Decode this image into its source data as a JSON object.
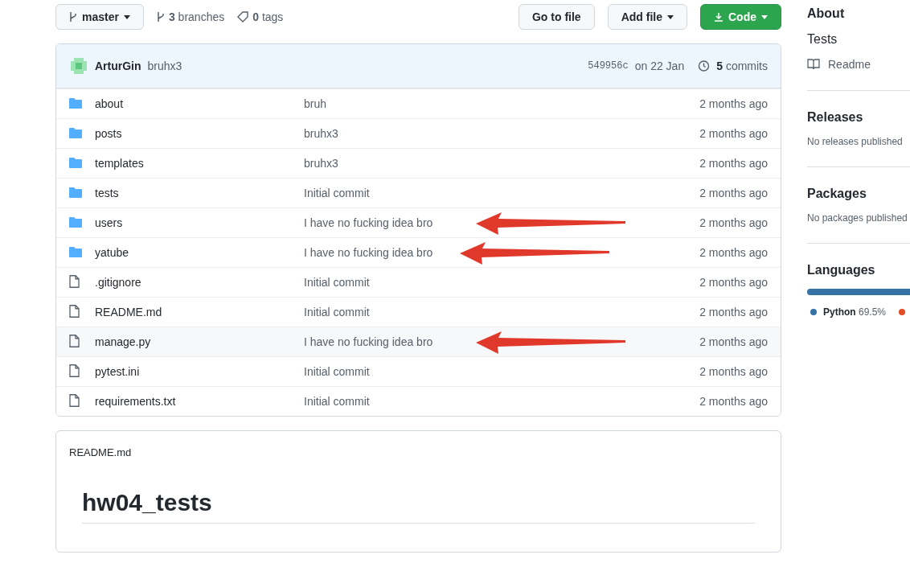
{
  "toolbar": {
    "branch": "master",
    "branches": {
      "count": "3",
      "label": "branches"
    },
    "tags": {
      "count": "0",
      "label": "tags"
    },
    "buttons": [
      {
        "kind": "plain",
        "label": "Go to file"
      },
      {
        "kind": "menu",
        "label": "Add file"
      },
      {
        "kind": "primary",
        "label": "Code"
      }
    ]
  },
  "commit_bar": {
    "author": "ArturGin",
    "message": "bruhx3",
    "hash": "549956c",
    "date": "on 22 Jan",
    "commits": {
      "count": "5",
      "label": "commits"
    }
  },
  "files": [
    {
      "kind": "folder",
      "name": "about",
      "message": "bruh",
      "age": "2 months ago",
      "highlighted": false,
      "arrow": false
    },
    {
      "kind": "folder",
      "name": "posts",
      "message": "bruhx3",
      "age": "2 months ago",
      "highlighted": false,
      "arrow": false
    },
    {
      "kind": "folder",
      "name": "templates",
      "message": "bruhx3",
      "age": "2 months ago",
      "highlighted": false,
      "arrow": false
    },
    {
      "kind": "folder",
      "name": "tests",
      "message": "Initial commit",
      "age": "2 months ago",
      "highlighted": false,
      "arrow": false
    },
    {
      "kind": "folder",
      "name": "users",
      "message": "I have no fucking idea bro",
      "age": "2 months ago",
      "highlighted": false,
      "arrow": true
    },
    {
      "kind": "folder",
      "name": "yatube",
      "message": "I have no fucking idea bro",
      "age": "2 months ago",
      "highlighted": false,
      "arrow": true
    },
    {
      "kind": "file",
      "name": ".gitignore",
      "message": "Initial commit",
      "age": "2 months ago",
      "highlighted": false,
      "arrow": false
    },
    {
      "kind": "file",
      "name": "README.md",
      "message": "Initial commit",
      "age": "2 months ago",
      "highlighted": false,
      "arrow": false
    },
    {
      "kind": "file",
      "name": "manage.py",
      "message": "I have no fucking idea bro",
      "age": "2 months ago",
      "highlighted": true,
      "arrow": true
    },
    {
      "kind": "file",
      "name": "pytest.ini",
      "message": "Initial commit",
      "age": "2 months ago",
      "highlighted": false,
      "arrow": false
    },
    {
      "kind": "file",
      "name": "requirements.txt",
      "message": "Initial commit",
      "age": "2 months ago",
      "highlighted": false,
      "arrow": false
    }
  ],
  "readme": {
    "filename": "README.md",
    "heading": "hw04_tests"
  },
  "sidebar": {
    "about": {
      "title": "About",
      "description": "Tests",
      "readme_link": "Readme"
    },
    "releases": {
      "title": "Releases",
      "note": "No releases published"
    },
    "packages": {
      "title": "Packages",
      "note": "No packages published"
    },
    "languages": {
      "title": "Languages",
      "items": [
        {
          "name": "Python",
          "percent": "69.5%",
          "color": "#3572a5"
        },
        {
          "color": "#e34c26"
        }
      ]
    }
  }
}
